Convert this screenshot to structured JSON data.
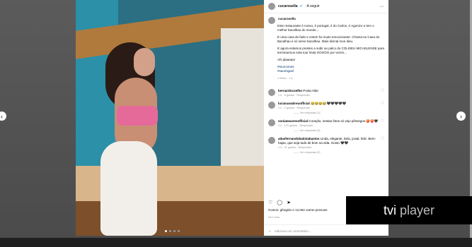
{
  "post": {
    "username": "cucarosella",
    "follow_label": "· A seguir",
    "more": "···",
    "caption_lines": [
      "Este restaurante é nosso, é portugal, é do Carlos, é Agonizo e tem o melhor bacalhau do mundo...",
      "É uma casa de fado e ontem foi muito emocionante. Chama-se Casa do Bacalhau e só serve bacalhau. Mais divinal mon dieu.",
      "E agora estamos prestes a subir ao palco do COLISEU MICAELENSE para terminarmos esta tour linda OOOOO por vezes...",
      "Ahi jáaaaaa!"
    ],
    "hashtags": [
      "#tourcomes",
      "#saomiguel"
    ],
    "caption_meta": "1 Ilhora  ·  1 d",
    "comments": [
      {
        "user": "bernardocoelho",
        "text": "Posta Alta!",
        "meta": "1 h  ·  8 gostos  ·  Responder",
        "replies": ""
      },
      {
        "user": "lucianasabreuofficial",
        "text": "😂😂😂😂🖤🖤🖤🖤🖤",
        "meta": "1 h  ·  2 gostos  ·  Responder",
        "replies": "—— Ver respostas (1)"
      },
      {
        "user": "soniatavaresofficial",
        "text": "Coração, nestas fotos só vejo pêssegos 🍑🍑🖤",
        "meta": "1 h  ·  172 gostos  ·  Responder",
        "replies": "—— Ver respostas (3)"
      },
      {
        "user": "adasfernandobatistabastos",
        "text": "Linda, elegante, bela, jovial, feliz. Bem-hajas, que seja tudo de bom na vida. Gosto 🖤🖤",
        "meta": "1 h  ·  37 gostos  ·  Responder",
        "replies": "—— Ver respostas (2)"
      }
    ],
    "likes_text": "Gostos: gfragido e 13,062 outras pessoas",
    "date": "Há 1 hora",
    "add_comment_placeholder": "Adiciona um comentário..."
  },
  "icons": [
    "heart-icon",
    "comment-icon",
    "share-icon",
    "bookmark-icon",
    "emoji-icon",
    "nav-chevron-left-icon",
    "nav-chevron-right-icon"
  ],
  "overlay": {
    "brand": "tvi",
    "brand2": "player"
  }
}
